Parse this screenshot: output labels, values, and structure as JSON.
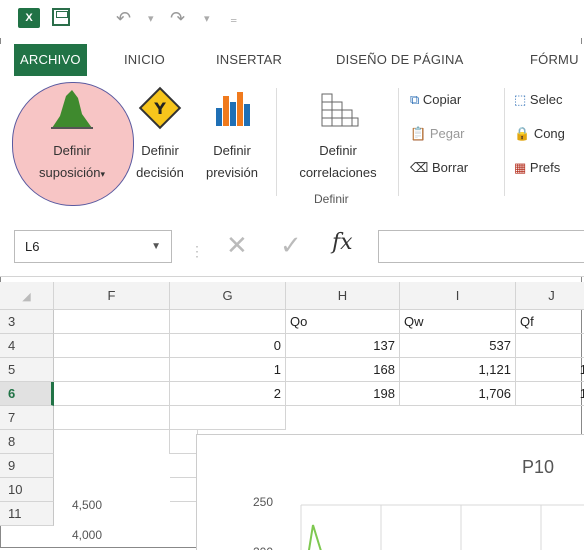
{
  "app": {
    "logo_text": "X"
  },
  "tabs": [
    "ARCHIVO",
    "INICIO",
    "INSERTAR",
    "DISEÑO DE PÁGINA",
    "FÓRMU"
  ],
  "ribbon": {
    "define_assumption": {
      "line1": "Definir",
      "line2": "suposición"
    },
    "define_decision": {
      "line1": "Definir",
      "line2": "decisión"
    },
    "define_forecast": {
      "line1": "Definir",
      "line2": "previsión"
    },
    "define_correlations": {
      "line1": "Definir",
      "line2": "correlaciones"
    },
    "group_label": "Definir",
    "copy": "Copiar",
    "paste": "Pegar",
    "clear": "Borrar",
    "select": "Selec",
    "freeze": "Cong",
    "prefs": "Prefs"
  },
  "formula_bar": {
    "name_box": "L6",
    "fx": "fx"
  },
  "columns": [
    "F",
    "G",
    "H",
    "I",
    "J"
  ],
  "rows": [
    "3",
    "4",
    "5",
    "6",
    "7",
    "8",
    "9",
    "10",
    "11"
  ],
  "table": {
    "header": {
      "H": "Qo",
      "I": "Qw",
      "J": "Qf"
    },
    "data": [
      {
        "G": "0",
        "H": "137",
        "I": "537",
        "J": ""
      },
      {
        "G": "1",
        "H": "168",
        "I": "1,121",
        "J": "1"
      },
      {
        "G": "2",
        "H": "198",
        "I": "1,706",
        "J": "1"
      }
    ]
  },
  "chart": {
    "title": "P10",
    "left_axis": [
      "4,500",
      "4,000"
    ],
    "right_axis": [
      "250",
      "200"
    ]
  },
  "colors": {
    "excel_green": "#217346",
    "highlight": "#f3a0a0"
  }
}
